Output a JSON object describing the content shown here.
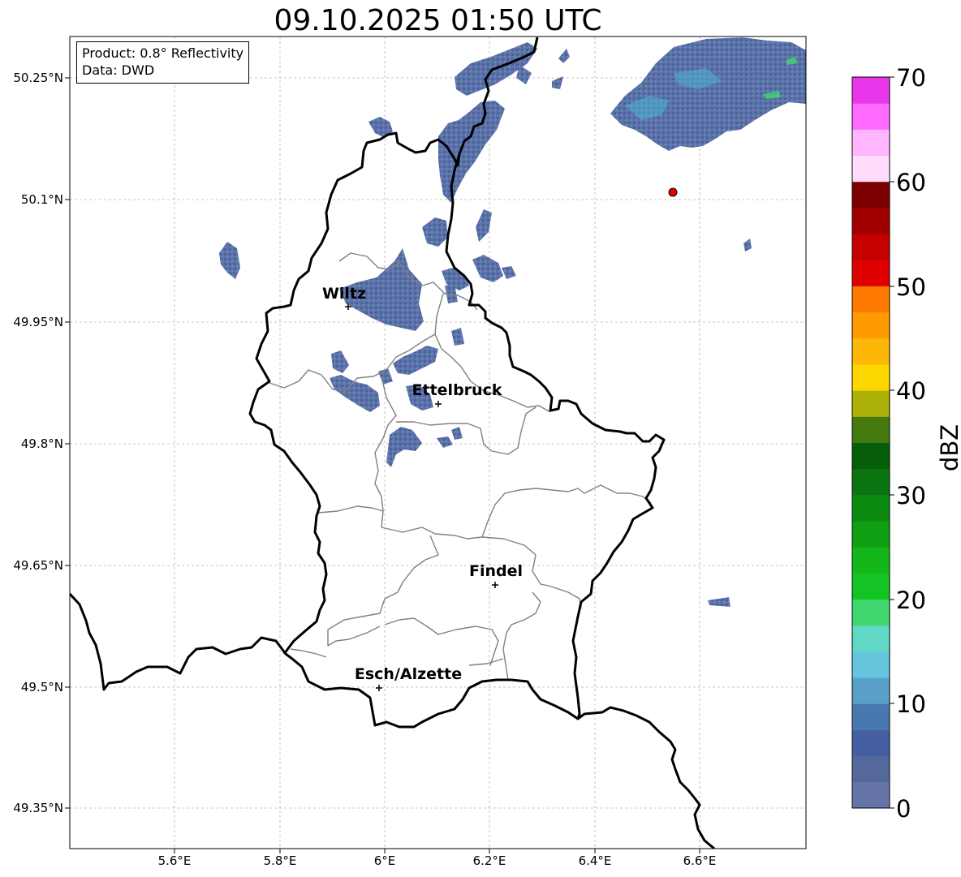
{
  "title": "09.10.2025 01:50 UTC",
  "info_box": {
    "product": "Product: 0.8° Reflectivity",
    "source": "Data: DWD"
  },
  "axes": {
    "lat_ticks": [
      "50.25°N",
      "50.1°N",
      "49.95°N",
      "49.8°N",
      "49.65°N",
      "49.5°N",
      "49.35°N"
    ],
    "lon_ticks": [
      "5.6°E",
      "5.8°E",
      "6°E",
      "6.2°E",
      "6.4°E",
      "6.6°E"
    ]
  },
  "cities": [
    {
      "name": "Wiltz"
    },
    {
      "name": "Ettelbruck"
    },
    {
      "name": "Findel"
    },
    {
      "name": "Esch/Alzette"
    }
  ],
  "colorbar": {
    "label": "dBZ",
    "ticks": [
      "0",
      "10",
      "20",
      "30",
      "40",
      "50",
      "60",
      "70"
    ],
    "colors": [
      "#6575a9",
      "#54689c",
      "#4560a2",
      "#4878b0",
      "#58a0c8",
      "#66c4dc",
      "#60d8c4",
      "#40d670",
      "#14c424",
      "#14b71a",
      "#10a014",
      "#0c8a10",
      "#0a7510",
      "#065e0a",
      "#43790f",
      "#acb108",
      "#ffd700",
      "#fdb707",
      "#ff9a00",
      "#ff7a00",
      "#e10000",
      "#c60000",
      "#a00000",
      "#7c0000",
      "#ffdcfc",
      "#ffb6ff",
      "#ff6aff",
      "#ea36ea"
    ]
  },
  "colors": {
    "echo_main": "#5d74a8",
    "echo_light": "#4bb6d0",
    "echo_bright": "#40d670",
    "radar_site": "#e40000"
  }
}
